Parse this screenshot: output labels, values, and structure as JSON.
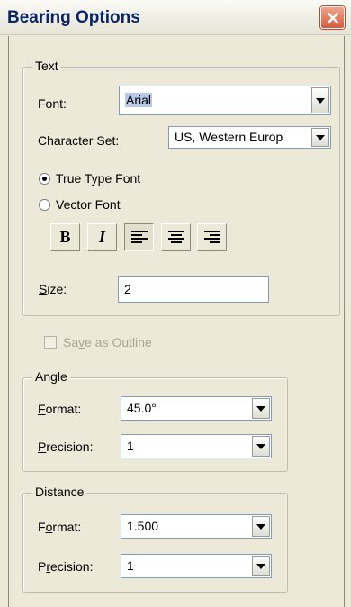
{
  "window": {
    "title": "Bearing Options"
  },
  "text_group": {
    "legend": "Text",
    "font_label": "Font:",
    "font_value": "Arial",
    "charset_label": "Character Set:",
    "charset_value": "US, Western Europ",
    "true_type_label": "True Type Font",
    "vector_label": "Vector Font",
    "font_type_selected": "True Type Font",
    "bold_label": "B",
    "italic_label": "I",
    "size_label_u": "S",
    "size_label_rest": "ize:",
    "size_value": "2"
  },
  "outline": {
    "label_pre": "Sa",
    "label_u": "v",
    "label_post": "e as Outline",
    "checked": false,
    "enabled": false
  },
  "angle_group": {
    "legend": "Angle",
    "format_label_u": "F",
    "format_label_rest": "ormat:",
    "format_value": "45.0°",
    "precision_label_u": "P",
    "precision_label_rest": "recision:",
    "precision_value": "1"
  },
  "distance_group": {
    "legend": "Distance",
    "format_label_pre": "F",
    "format_label_u": "o",
    "format_label_post": "rmat:",
    "format_value": "1.500",
    "precision_label_pre": "P",
    "precision_label_u": "r",
    "precision_label_post": "ecision:",
    "precision_value": "1"
  }
}
